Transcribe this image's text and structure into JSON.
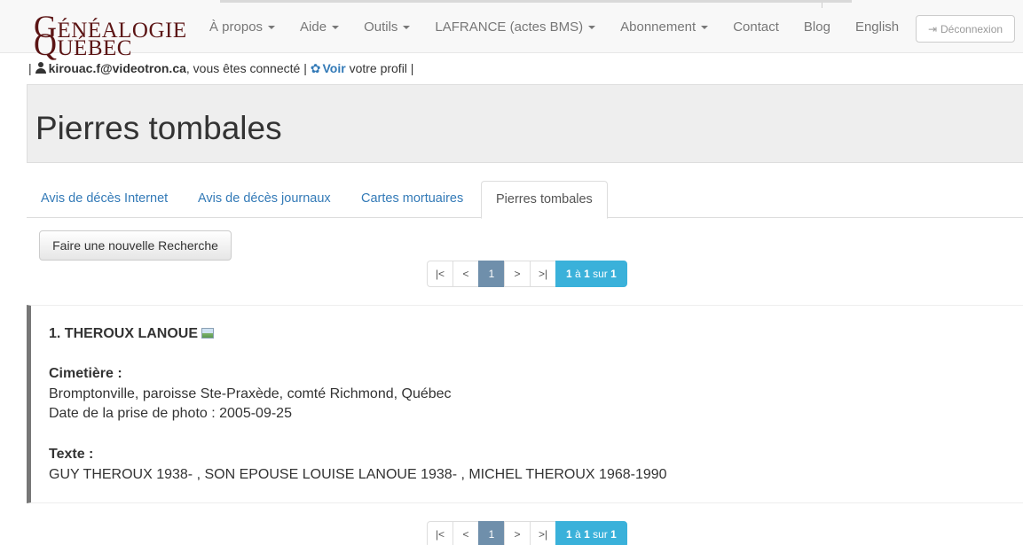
{
  "navbar": {
    "logo": {
      "line1_initial": "G",
      "line1_rest": "ÉNÉALOGIE",
      "line2_initial": "Q",
      "line2_rest": "UÉBEC"
    },
    "items": [
      {
        "label": "À propos",
        "dropdown": true
      },
      {
        "label": "Aide",
        "dropdown": true
      },
      {
        "label": "Outils",
        "dropdown": true
      },
      {
        "label": "LAFRANCE (actes BMS)",
        "dropdown": true
      },
      {
        "label": "Abonnement",
        "dropdown": true
      },
      {
        "label": "Contact",
        "dropdown": false
      },
      {
        "label": "Blog",
        "dropdown": false
      },
      {
        "label": "English",
        "dropdown": false
      }
    ],
    "logout_label": "Déconnexion",
    "logout_icon": "sign-out-icon"
  },
  "user_line": {
    "sep_start": "|",
    "email": "kirouac.f@videotron.ca",
    "connected_text": ", vous êtes connecté |",
    "voir_label": "Voir",
    "profile_text": "votre profil |",
    "user_icon": "user-icon",
    "gear_icon": "gear-icon"
  },
  "page_title": "Pierres tombales",
  "tabs": [
    {
      "label": "Avis de décès Internet",
      "active": false
    },
    {
      "label": "Avis de décès journaux",
      "active": false
    },
    {
      "label": "Cartes mortuaires",
      "active": false
    },
    {
      "label": "Pierres tombales",
      "active": true
    }
  ],
  "search_button_label": "Faire une nouvelle Recherche",
  "pagination": {
    "first": "|<",
    "prev": "<",
    "current": "1",
    "next": ">",
    "last": ">|",
    "info_from": "1",
    "info_a": "à",
    "info_to": "1",
    "info_sur": "sur",
    "info_total": "1"
  },
  "result": {
    "title": "1. THEROUX LANOUE",
    "photo_icon": "photo-icon",
    "cemetery_label": "Cimetière :",
    "cemetery_value": "Bromptonville, paroisse Ste-Praxède, comté Richmond, Québec",
    "photo_date": "Date de la prise de photo : 2005-09-25",
    "text_label": "Texte :",
    "text_value": "GUY THEROUX 1938- , SON EPOUSE LOUISE LANOUE 1938- , MICHEL THEROUX 1968-1990"
  },
  "colors": {
    "logo": "#5b1414",
    "link": "#337ab7",
    "pager_active": "#6f8fab",
    "pager_info": "#3ab1da",
    "result_border": "#777777"
  }
}
